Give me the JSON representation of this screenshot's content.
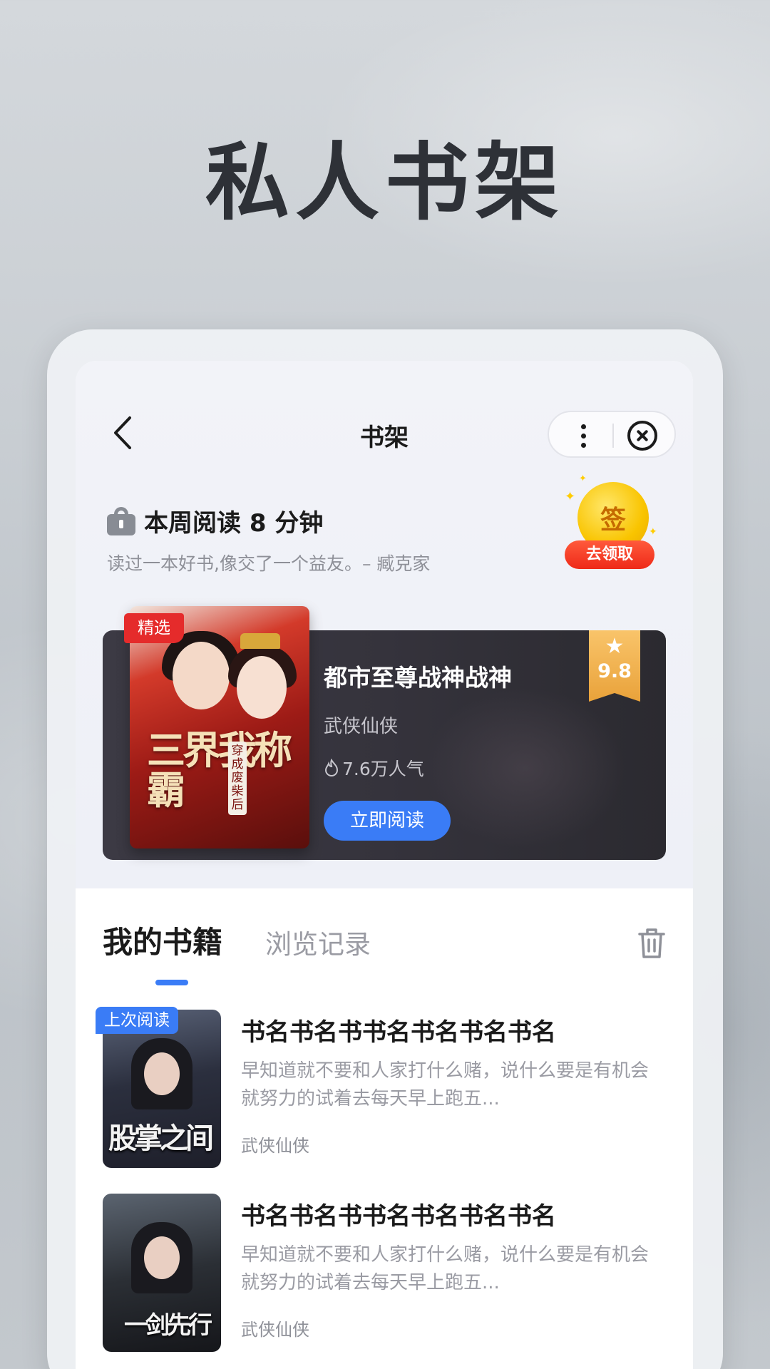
{
  "hero_title": "私人书架",
  "nav": {
    "title": "书架"
  },
  "stats": {
    "text": "本周阅读 8 分钟",
    "quote": "读过一本好书,像交了一个益友。– 臧克家"
  },
  "signin": {
    "coin_label": "签",
    "button": "去领取"
  },
  "featured": {
    "badge": "精选",
    "cover_text": "三界我称霸",
    "cover_sub": "穿成废柴后",
    "title": "都市至尊战神战神",
    "genre": "武侠仙侠",
    "popularity": "7.6万人气",
    "read_button": "立即阅读",
    "rating": "9.8"
  },
  "tabs": {
    "active": "我的书籍",
    "inactive": "浏览记录"
  },
  "books": [
    {
      "badge": "上次阅读",
      "cover_text": "股掌之间",
      "title": "书名书名书书名书名书名书名",
      "desc": "早知道就不要和人家打什么赌，说什么要是有机会就努力的试着去每天早上跑五...",
      "genre": "武侠仙侠"
    },
    {
      "cover_text": "一剑先行",
      "title": "书名书名书书名书名书名书名",
      "desc": "早知道就不要和人家打什么赌，说什么要是有机会就努力的试着去每天早上跑五...",
      "genre": "武侠仙侠"
    }
  ],
  "colors": {
    "accent": "#3a7cf6",
    "badge_red": "#e52b2b",
    "rating_gold": "#e9a23a"
  }
}
